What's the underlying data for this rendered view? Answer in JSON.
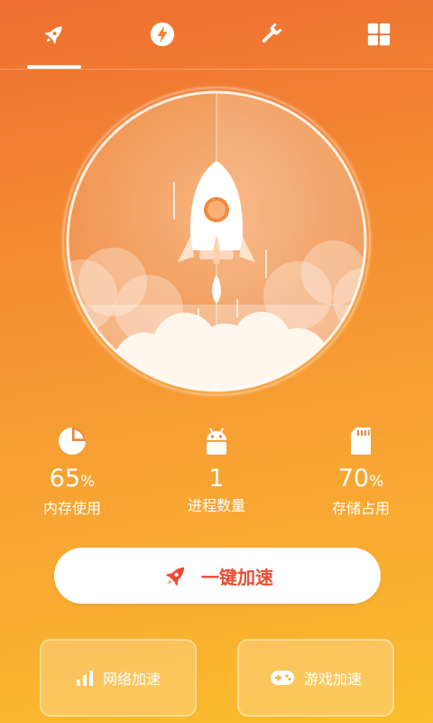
{
  "tabs": [
    {
      "icon": "rocket-icon",
      "active": true
    },
    {
      "icon": "lightning-icon",
      "active": false
    },
    {
      "icon": "wrench-icon",
      "active": false
    },
    {
      "icon": "grid-icon",
      "active": false
    }
  ],
  "stats": {
    "memory": {
      "value": "65",
      "unit": "%",
      "label": "内存使用",
      "icon": "pie-chart-icon"
    },
    "process": {
      "value": "1",
      "unit": "",
      "label": "进程数量",
      "icon": "android-icon"
    },
    "storage": {
      "value": "70",
      "unit": "%",
      "label": "存储占用",
      "icon": "sd-card-icon"
    }
  },
  "boost_button": {
    "label": "一键加速",
    "icon": "rocket-icon"
  },
  "cards": {
    "network": {
      "label": "网络加速",
      "icon": "signal-bars-icon"
    },
    "game": {
      "label": "游戏加速",
      "icon": "gamepad-icon"
    }
  },
  "colors": {
    "gradient_top": "#EE6E30",
    "gradient_bottom": "#FBBD2C",
    "accent_red": "#EA4C34"
  }
}
